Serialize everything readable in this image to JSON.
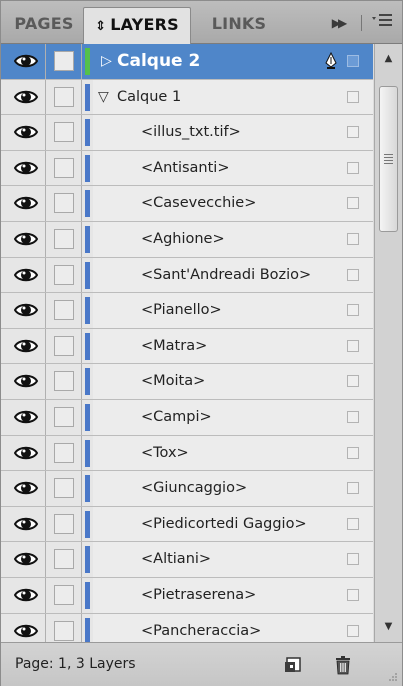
{
  "tabs": [
    {
      "label": "PAGES",
      "active": false
    },
    {
      "label": "LAYERS",
      "active": true
    },
    {
      "label": "LINKS",
      "active": false
    }
  ],
  "tab_arrow": "⇕",
  "layers": [
    {
      "label": "Calque 2",
      "level": 0,
      "expanded": false,
      "selected": true,
      "color": "#55c14a"
    },
    {
      "label": "Calque 1",
      "level": 0,
      "expanded": true,
      "selected": false,
      "color": "#4a78c8"
    }
  ],
  "items": [
    "<illus_txt.tif>",
    "<Antisanti>",
    "<Casevecchie>",
    "<Aghione>",
    "<Sant'Andreadi Bozio>",
    "<Pianello>",
    "<Matra>",
    "<Moita>",
    "<Campi>",
    "<Tox>",
    "<Giuncaggio>",
    "<Piedicortedi Gaggio>",
    "<Altiani>",
    "<Pietraserena>",
    "<Pancheraccia>"
  ],
  "footer": {
    "status": "Page: 1, 3 Layers"
  },
  "colors": {
    "selected": "#4f86c9",
    "panel": "#dcdcdc"
  }
}
